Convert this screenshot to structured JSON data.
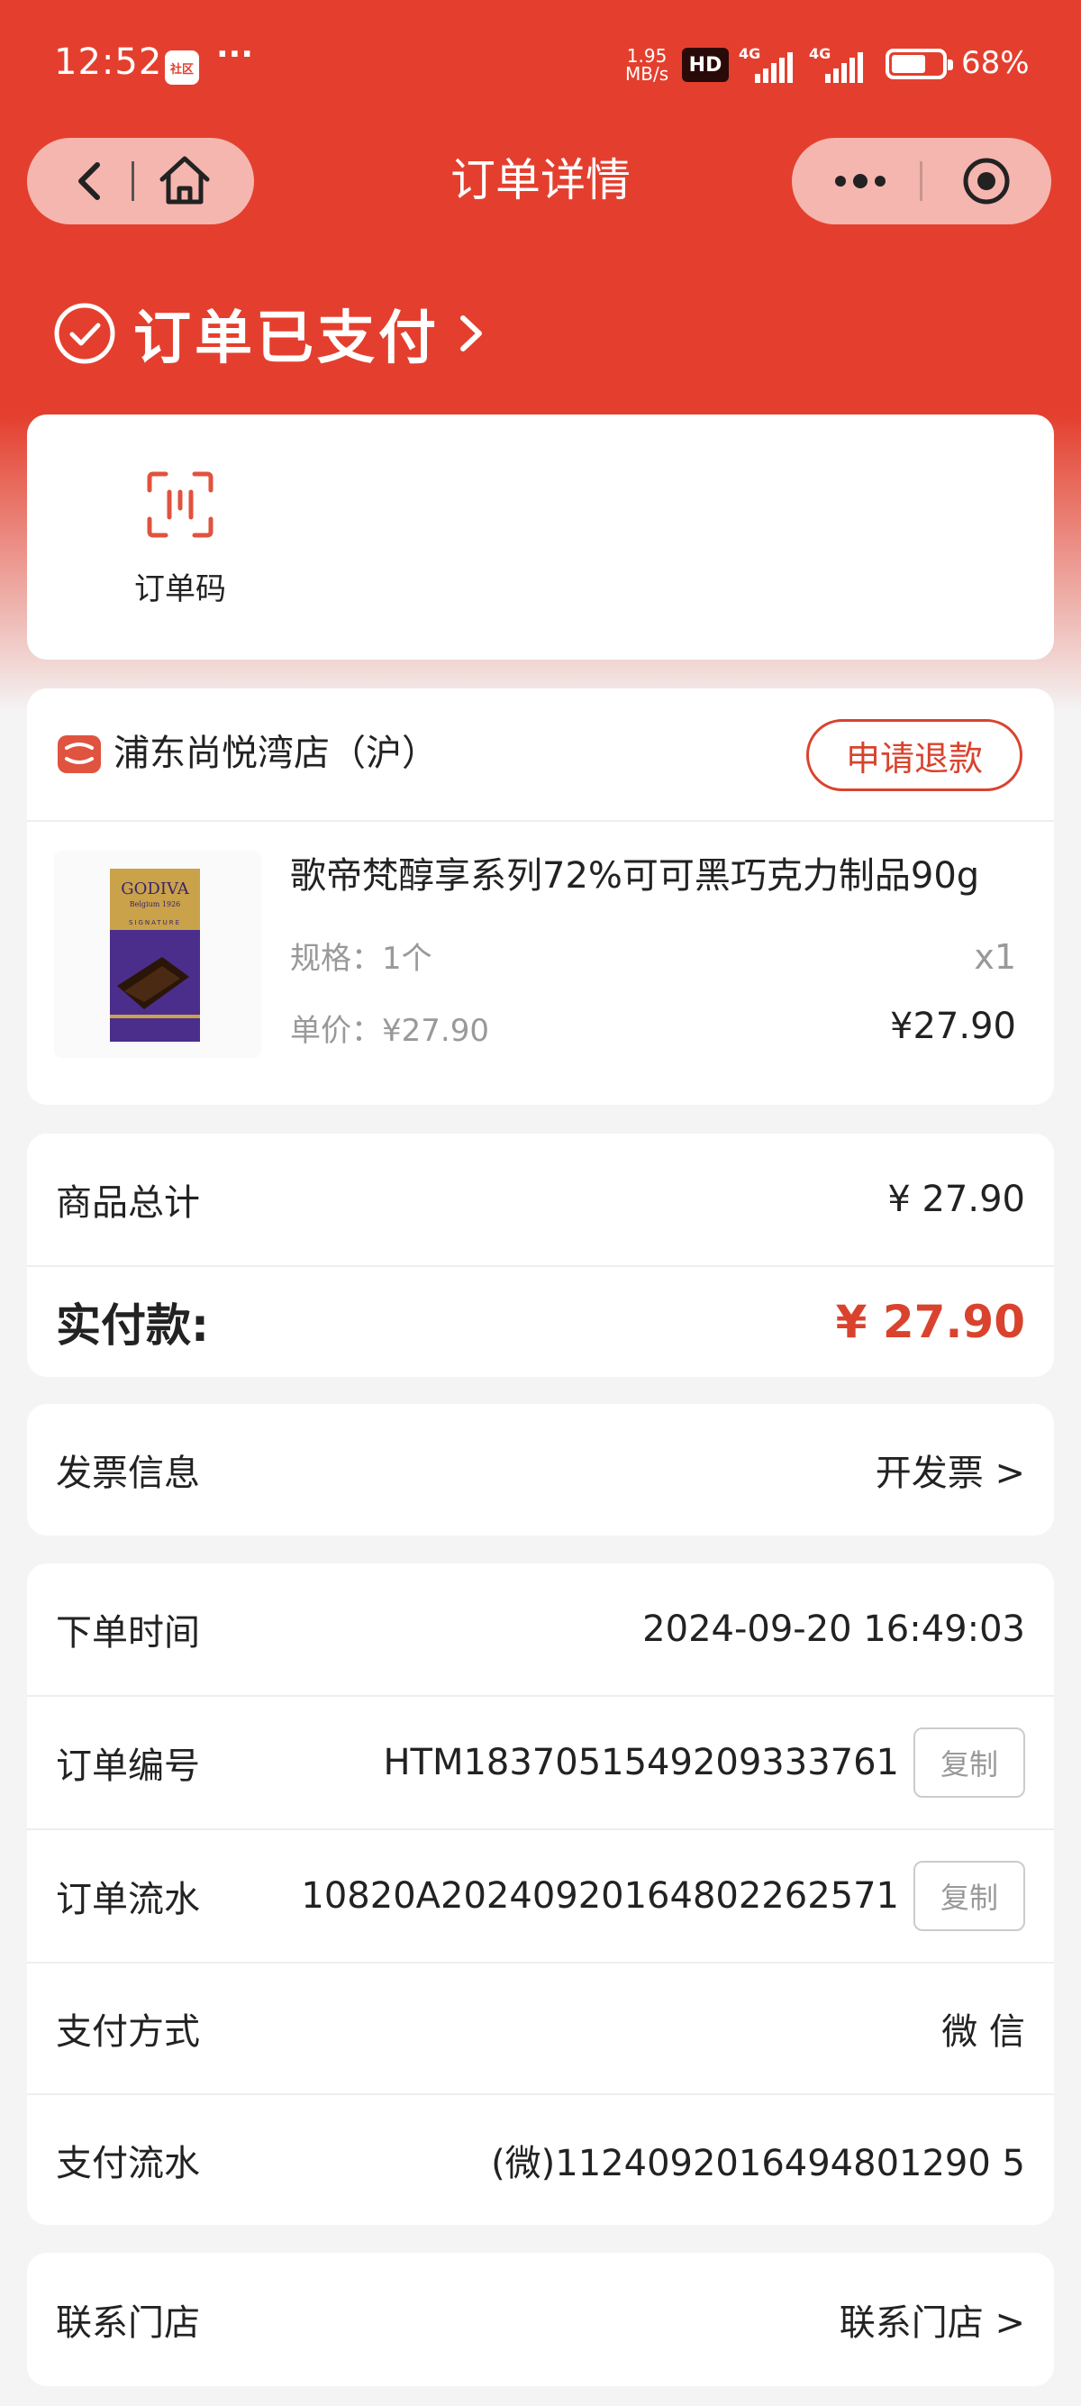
{
  "status_bar": {
    "time": "12:52",
    "app_badge": "社区",
    "dots": "···",
    "speed_value": "1.95",
    "speed_unit": "MB/s",
    "hd": "HD",
    "net1": "4G",
    "net2": "4G",
    "battery_percent": "68%",
    "battery_level": 0.68
  },
  "nav": {
    "title": "订单详情"
  },
  "order": {
    "status_text": "订单已支付",
    "code_label": "订单码"
  },
  "store": {
    "name": "浦东尚悦湾店（沪）",
    "refund_label": "申请退款"
  },
  "product": {
    "name": "歌帝梵醇享系列72%可可黑巧克力制品90g",
    "spec": "规格：1个",
    "qty": "x1",
    "unit_price": "单价：¥27.90",
    "total": "¥27.90",
    "image_brand": "GODIVA",
    "image_sub": "Belgium 1926",
    "image_series": "SIGNATURE"
  },
  "summary": {
    "goods_total_label": "商品总计",
    "goods_total_value": "¥ 27.90",
    "paid_label": "实付款:",
    "paid_value": "¥ 27.90"
  },
  "invoice": {
    "label": "发票信息",
    "action": "开发票 >"
  },
  "details": {
    "order_time_label": "下单时间",
    "order_time_value": "2024-09-20 16:49:03",
    "order_no_label": "订单编号",
    "order_no_value": "HTM1837051549209333761",
    "order_flow_label": "订单流水",
    "order_flow_value": "10820A20240920164802262571",
    "pay_method_label": "支付方式",
    "pay_method_value": "微 信",
    "pay_flow_label": "支付流水",
    "pay_flow_value": "(微)1124092016494801290 5",
    "copy_label": "复制"
  },
  "contact": {
    "label": "联系门店",
    "action": "联系门店 >"
  },
  "colors": {
    "brand_red": "#e43f2e",
    "price_red": "#d9432e"
  }
}
